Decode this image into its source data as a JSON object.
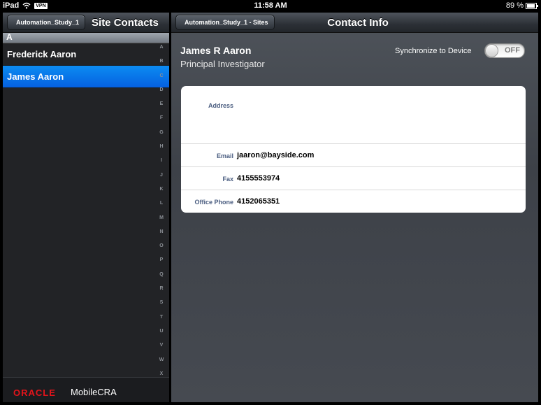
{
  "status": {
    "device": "iPad",
    "vpn": "VPN",
    "time": "11:58 AM",
    "battery": "89 %",
    "battery_level": 0.89
  },
  "left": {
    "back_label": "Automation_Study_1",
    "title": "Site Contacts",
    "section": "A",
    "contacts": [
      "Frederick Aaron",
      "James Aaron"
    ],
    "selected_index": 1,
    "index_letters": [
      "A",
      "B",
      "C",
      "D",
      "E",
      "F",
      "G",
      "H",
      "I",
      "J",
      "K",
      "L",
      "M",
      "N",
      "O",
      "P",
      "Q",
      "R",
      "S",
      "T",
      "U",
      "V",
      "W",
      "X"
    ],
    "brand_oracle": "ORACLE",
    "brand_product": "MobileCRA"
  },
  "right": {
    "back_label": "Automation_Study_1 - Sites",
    "title": "Contact Info",
    "name": "James R Aaron",
    "role": "Principal Investigator",
    "sync_label": "Synchronize to Device",
    "sync_state": "OFF",
    "fields": {
      "address_label": "Address",
      "address_value": "",
      "email_label": "Email",
      "email_value": "jaaron@bayside.com",
      "fax_label": "Fax",
      "fax_value": "4155553974",
      "phone_label": "Office Phone",
      "phone_value": "4152065351"
    }
  },
  "colors": {
    "selection": "#0a74ea",
    "label": "#4a5d80",
    "oracle": "#e2141b"
  }
}
